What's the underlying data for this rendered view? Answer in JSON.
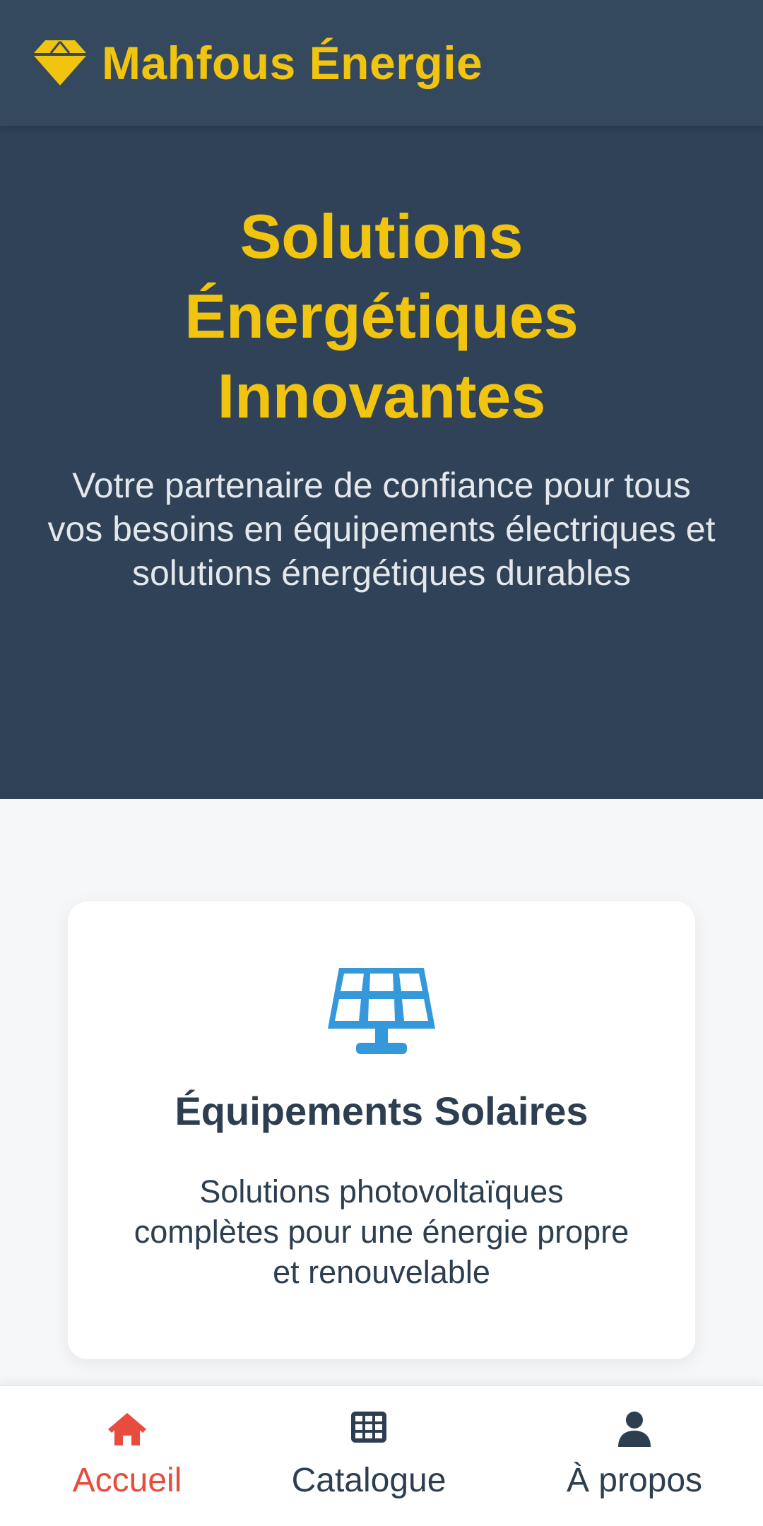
{
  "header": {
    "brand_name": "Mahfous Énergie",
    "brand_icon": "gem-icon",
    "brand_color": "#f1c40f",
    "background": "#34495e"
  },
  "hero": {
    "title": "Solutions Énergétiques Innovantes",
    "subtitle": "Votre partenaire de confiance pour tous vos besoins en équipements électriques et solutions énergétiques durables"
  },
  "services": [
    {
      "icon": "solar-panel-icon",
      "icon_color": "#3498db",
      "title": "Équipements Solaires",
      "description": "Solutions photovoltaïques complètes pour une énergie propre et renouvelable"
    }
  ],
  "bottom_nav": {
    "active_color": "#e74c3c",
    "items": [
      {
        "label": "Accueil",
        "icon": "home-icon",
        "active": true
      },
      {
        "label": "Catalogue",
        "icon": "grid-icon",
        "active": false
      },
      {
        "label": "À propos",
        "icon": "user-icon",
        "active": false
      }
    ]
  }
}
